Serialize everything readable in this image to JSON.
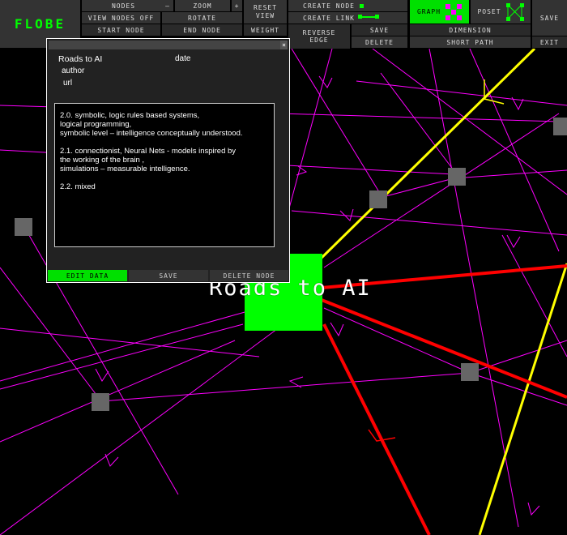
{
  "app": {
    "logo": "FLOBE"
  },
  "toolbar": {
    "nodes": "NODES",
    "zoom_minus": "–",
    "zoom": "ZOOM",
    "zoom_plus": "+",
    "view_nodes_off": "VIEW NODES OFF",
    "rotate": "ROTATE",
    "start_node": "START NODE",
    "end_node": "END NODE",
    "reset_view_1": "RESET",
    "reset_view_2": "VIEW",
    "weight": "WEIGHT",
    "create_node": "CREATE NODE",
    "create_link": "CREATE LINK",
    "reverse_edge_1": "REVERSE",
    "reverse_edge_2": "EDGE",
    "save_small": "SAVE",
    "delete": "DELETE",
    "graph": "GRAPH",
    "poset": "POSET",
    "dimension": "DIMENSION",
    "short_path": "SHORT PATH",
    "save": "SAVE",
    "exit": "EXIT"
  },
  "panel": {
    "close": "×",
    "title": "Roads to AI",
    "date": "date",
    "author": "author",
    "url": "url",
    "content": "2.0. symbolic, logic rules based systems,\nlogical programming,\nsymbolic level – intelligence conceptually understood.\n\n2.1. connectionist, Neural Nets - models inspired by\nthe working of the brain ,\nsimulations – measurable intelligence.\n\n2.2. mixed",
    "edit_data": "EDIT DATA",
    "save": "SAVE",
    "delete_node": "DELETE NODE"
  },
  "graph": {
    "selected_node_label": "Roads to AI",
    "colors": {
      "active": "#00ff00",
      "node": "#666666",
      "link": "#ff00ff",
      "path_red": "#ff0000",
      "path_yellow": "#ffff00"
    }
  }
}
